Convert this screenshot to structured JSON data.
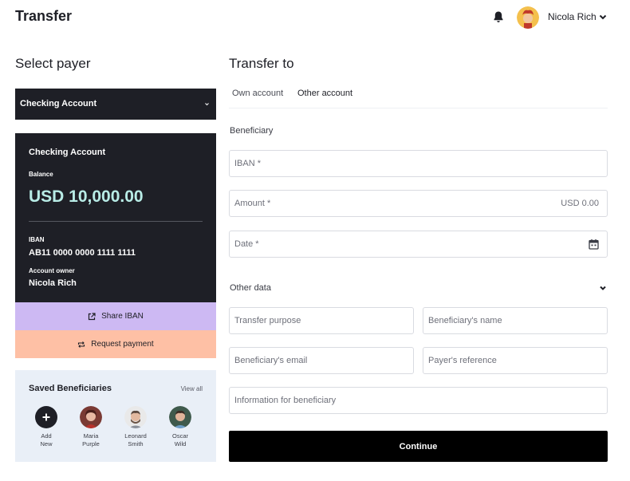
{
  "header": {
    "title": "Transfer",
    "user_name": "Nicola Rich"
  },
  "payer": {
    "heading": "Select payer",
    "selected_account": "Checking Account",
    "card": {
      "title": "Checking Account",
      "balance_label": "Balance",
      "balance": "USD 10,000.00",
      "iban_label": "IBAN",
      "iban": "AB11 0000 0000 1111 1111",
      "owner_label": "Account owner",
      "owner": "Nicola Rich"
    },
    "share_label": "Share IBAN",
    "request_label": "Request payment"
  },
  "saved": {
    "title": "Saved Beneficiaries",
    "view_all": "View all",
    "items": [
      {
        "line1": "Add",
        "line2": "New"
      },
      {
        "line1": "Maria",
        "line2": "Purple"
      },
      {
        "line1": "Leonard",
        "line2": "Smith"
      },
      {
        "line1": "Oscar",
        "line2": "Wild"
      }
    ]
  },
  "transfer": {
    "heading": "Transfer to",
    "tabs": [
      {
        "label": "Own account"
      },
      {
        "label": "Other account"
      }
    ],
    "beneficiary_label": "Beneficiary",
    "iban_placeholder": "IBAN *",
    "amount_placeholder": "Amount *",
    "amount_value": "USD 0.00",
    "date_placeholder": "Date *",
    "other_data_label": "Other data",
    "transfer_purpose": "Transfer purpose",
    "beneficiary_name": "Beneficiary's name",
    "beneficiary_email": "Beneficiary's email",
    "payer_reference": "Payer's reference",
    "info_for_beneficiary": "Information for beneficiary",
    "continue_label": "Continue"
  },
  "colors": {
    "dark": "#1e1f26",
    "balance": "#b8ece6",
    "share_bg": "#cdb9f3",
    "request_bg": "#fec0a5",
    "saved_bg": "#e9eff7"
  }
}
